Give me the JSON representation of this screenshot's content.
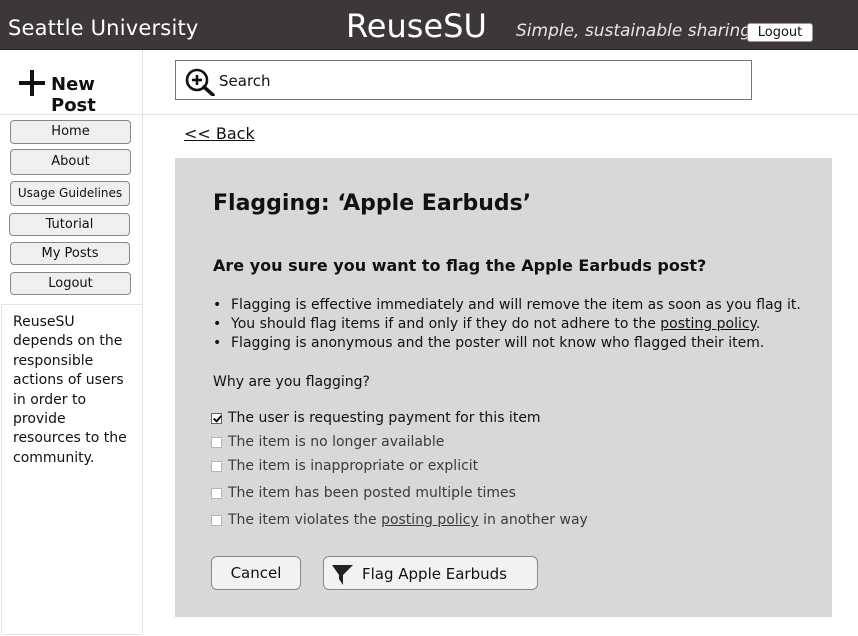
{
  "header": {
    "university": "Seattle University",
    "brand": "ReuseSU",
    "tagline": "Simple, sustainable sharing",
    "logout_label": "Logout"
  },
  "topbar": {
    "new_post_label": "New Post",
    "new_post_icon": "plus-icon",
    "search_label": "Search",
    "search_icon": "magnify-plus-icon"
  },
  "sidebar": {
    "items": [
      {
        "label": "Home"
      },
      {
        "label": "About"
      },
      {
        "label": "Usage Guidelines"
      },
      {
        "label": "Tutorial"
      },
      {
        "label": "My Posts"
      },
      {
        "label": "Logout"
      }
    ],
    "info_text": "ReuseSU depends on the responsible actions of users in order to provide resources to the community."
  },
  "main": {
    "back_label": "<< Back",
    "title": "Flagging: ‘Apple Earbuds’",
    "question": "Are you sure you want to flag the Apple Earbuds post?",
    "bullets": {
      "b1": "Flagging is effective immediately and will remove the item as soon as you flag it.",
      "b2_prefix": "You should flag items if and only if they do not adhere to the ",
      "b2_link": "posting policy",
      "b2_suffix": ".",
      "b3": "Flagging is anonymous and the poster will not know who flagged their item."
    },
    "why_label": "Why are you flagging?",
    "reasons": [
      {
        "label": "The user is requesting payment for this item",
        "checked": true
      },
      {
        "label": "The item is no longer available",
        "checked": false
      },
      {
        "label": "The item is inappropriate or explicit",
        "checked": false
      },
      {
        "label": "The item has been posted multiple times",
        "checked": false
      },
      {
        "label_prefix": "The item violates the ",
        "label_link": "posting policy",
        "label_suffix": " in another way",
        "checked": false
      }
    ],
    "cancel_label": "Cancel",
    "flag_label": "Flag Apple Earbuds",
    "flag_icon": "flag-funnel-icon"
  },
  "colors": {
    "header_bg": "#3d3837",
    "panel_bg": "#d8d8d8",
    "button_bg": "#efefef"
  }
}
